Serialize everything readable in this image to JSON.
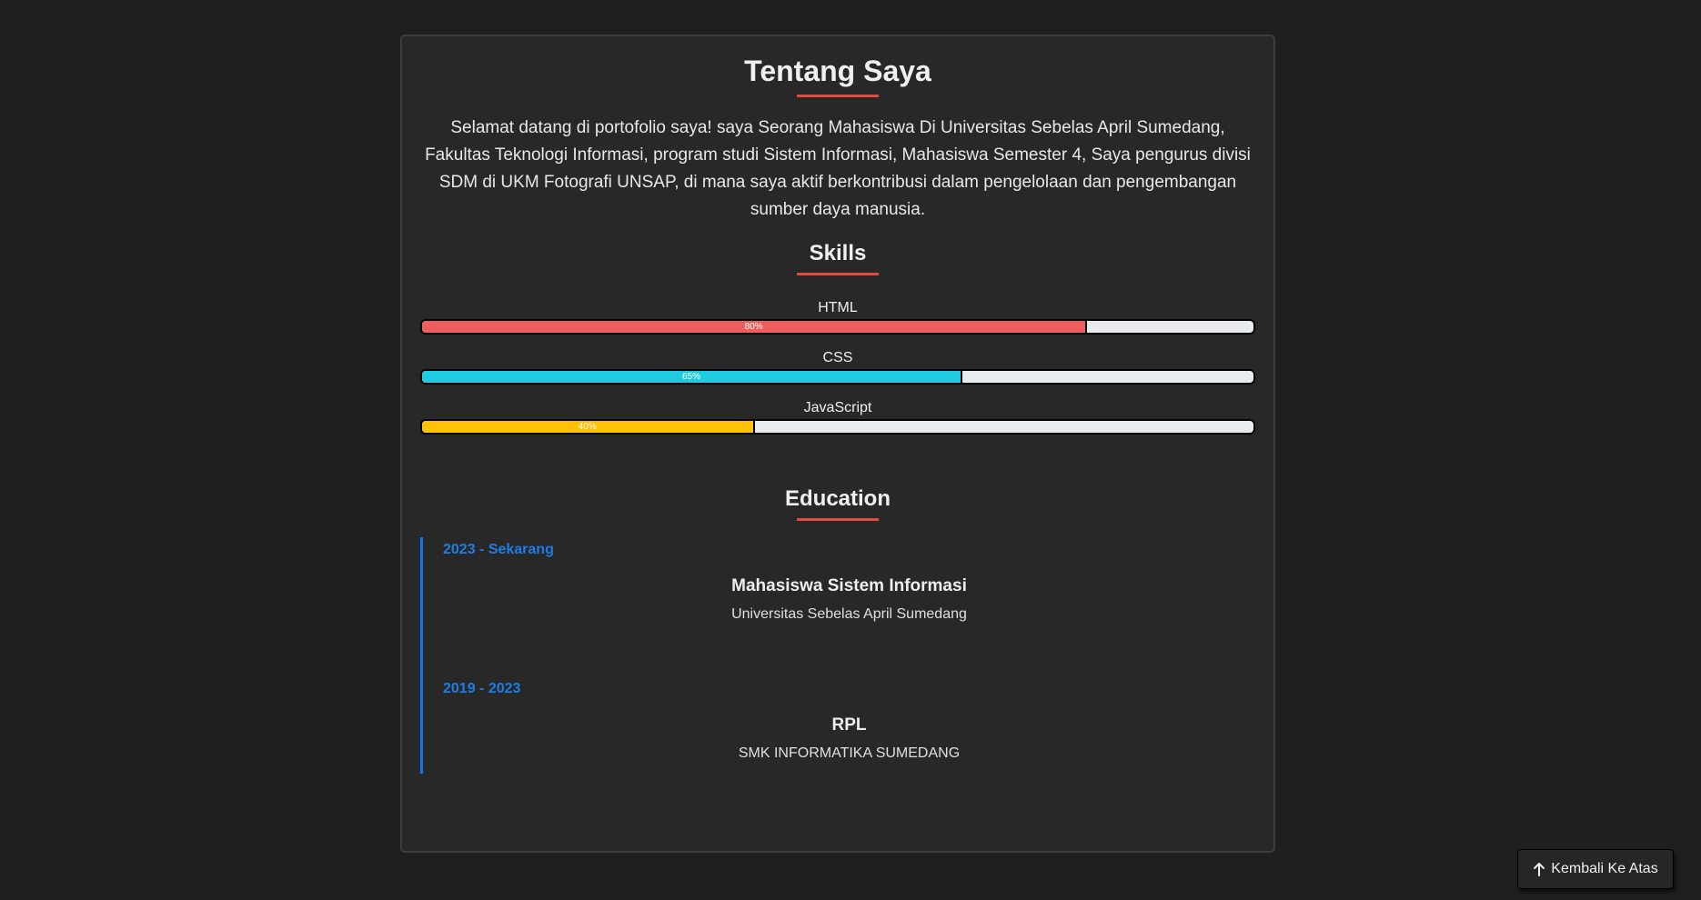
{
  "about": {
    "title": "Tentang Saya",
    "text": "Selamat datang di portofolio saya! saya Seorang Mahasiswa Di Universitas Sebelas April Sumedang, Fakultas Teknologi Informasi, program studi Sistem Informasi, Mahasiswa Semester 4, Saya pengurus divisi SDM di UKM Fotografi UNSAP, di mana saya aktif berkontribusi dalam pengelolaan dan pengembangan sumber daya manusia."
  },
  "skills": {
    "title": "Skills",
    "items": [
      {
        "name": "HTML",
        "percent": 80,
        "label": "80%",
        "color": "#f05d5e"
      },
      {
        "name": "CSS",
        "percent": 65,
        "label": "65%",
        "color": "#1ecbe1"
      },
      {
        "name": "JavaScript",
        "percent": 40,
        "label": "40%",
        "color": "#ffc107"
      }
    ]
  },
  "education": {
    "title": "Education",
    "items": [
      {
        "date": "2023 - Sekarang",
        "role": "Mahasiswa Sistem Informasi",
        "place": "Universitas Sebelas April Sumedang"
      },
      {
        "date": "2019 - 2023",
        "role": "RPL",
        "place": "SMK INFORMATIKA SUMEDANG"
      }
    ]
  },
  "back_to_top": {
    "label": "Kembali Ke Atas",
    "icon": "arrow-up-icon"
  },
  "colors": {
    "accent": "#e24c3f",
    "timeline": "#1a73e8",
    "background": "#1f1f1f",
    "card": "#282828"
  }
}
